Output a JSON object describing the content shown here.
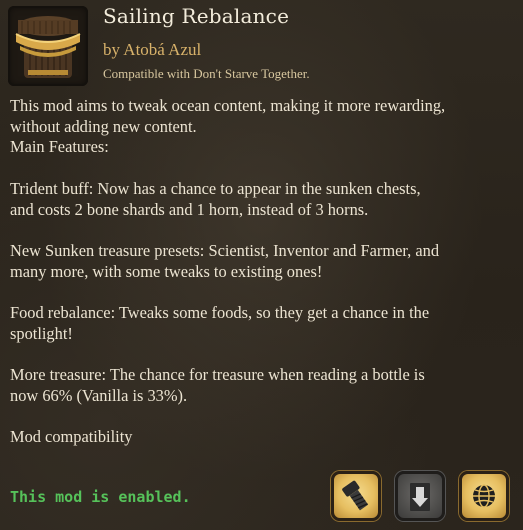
{
  "mod": {
    "title": "Sailing Rebalance",
    "author": "by Atobá Azul",
    "compatibility": "Compatible with Don't Starve Together."
  },
  "description": {
    "intro_line1": "This mod aims to tweak ocean content, making it more rewarding,",
    "intro_line2": "without adding new content.",
    "features_heading": "Main Features:",
    "trident_line1": "Trident buff: Now has a chance to appear in the sunken chests,",
    "trident_line2": "and costs 2 bone shards and 1 horn, instead of 3 horns.",
    "treasure_line1": "New Sunken treasure presets: Scientist, Inventor and Farmer, and",
    "treasure_line2": "many more, with some tweaks to existing ones!",
    "food_line1": "Food rebalance: Tweaks some foods, so they get a chance in the",
    "food_line2": "spotlight!",
    "more_line1": "More treasure: The chance for treasure when reading a bottle is",
    "more_line2": "now 66% (Vanilla is 33%).",
    "compat_heading": "Mod compatibility"
  },
  "status": {
    "text": "This mod is enabled.",
    "color": "#56c25a"
  },
  "actions": {
    "configure_icon": "wrench-bolt-icon",
    "update_icon": "download-arrow-icon",
    "workshop_icon": "globe-icon",
    "update_state": "disabled"
  },
  "colors": {
    "background": "#2a241d",
    "title": "#f3ecdb",
    "author": "#d8b26a",
    "button_gold": "#e6be60"
  }
}
